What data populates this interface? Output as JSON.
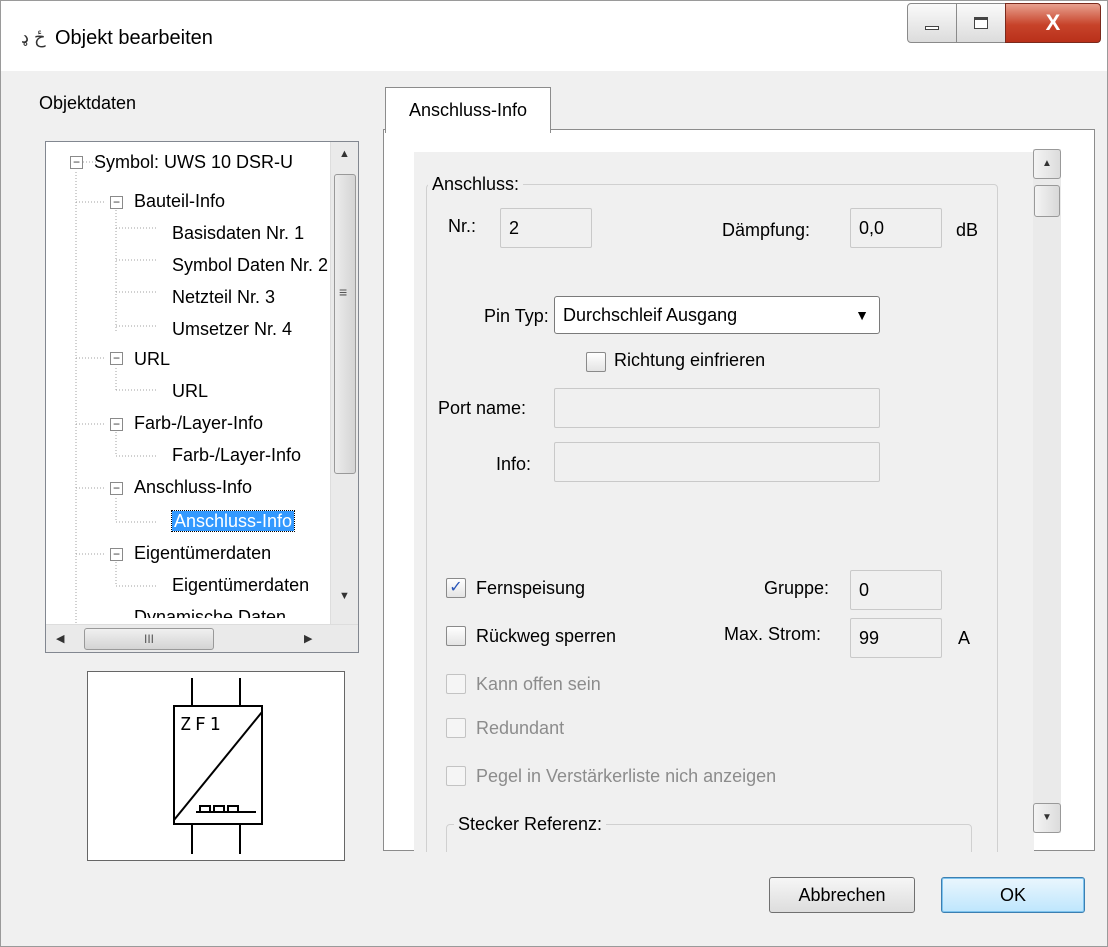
{
  "window": {
    "title": "Objekt bearbeiten",
    "icon_glyph": "ځ ډ",
    "minimize_icon": "minimize-icon",
    "maximize_icon": "maximize-icon",
    "close_glyph": "X"
  },
  "left": {
    "label": "Objektdaten",
    "tree": [
      {
        "label": "Symbol: UWS 10 DSR-U",
        "level": 0,
        "expandable": true
      },
      {
        "label": "Bauteil-Info",
        "level": 1,
        "expandable": true
      },
      {
        "label": "Basisdaten Nr. 1",
        "level": 2
      },
      {
        "label": "Symbol Daten Nr. 2",
        "level": 2
      },
      {
        "label": "Netzteil Nr. 3",
        "level": 2
      },
      {
        "label": "Umsetzer Nr. 4",
        "level": 2
      },
      {
        "label": "URL",
        "level": 1,
        "expandable": true
      },
      {
        "label": "URL",
        "level": 2
      },
      {
        "label": "Farb-/Layer-Info",
        "level": 1,
        "expandable": true
      },
      {
        "label": "Farb-/Layer-Info",
        "level": 2
      },
      {
        "label": "Anschluss-Info",
        "level": 1,
        "expandable": true
      },
      {
        "label": "Anschluss-Info",
        "level": 2,
        "selected": true
      },
      {
        "label": "Eigentümerdaten",
        "level": 1,
        "expandable": true
      },
      {
        "label": "Eigentümerdaten",
        "level": 2
      },
      {
        "label": "Dynamische Daten",
        "level": 1,
        "expandable": true
      }
    ],
    "hscroll_thumb": "III",
    "symbol_text": "ZF1"
  },
  "tab": {
    "label": "Anschluss-Info"
  },
  "form": {
    "anschluss_legend": "Anschluss:",
    "nr_label": "Nr.:",
    "nr_value": "2",
    "daempfung_label": "Dämpfung:",
    "daempfung_value": "0,0",
    "daempfung_unit": "dB",
    "pin_typ_label": "Pin Typ:",
    "pin_typ_value": "Durchschleif Ausgang",
    "richtung_label": "Richtung einfrieren",
    "richtung_checked": false,
    "port_name_label": "Port name:",
    "port_name_value": "",
    "info_label": "Info:",
    "info_value": "",
    "fernspeisung_label": "Fernspeisung",
    "fernspeisung_checked": true,
    "gruppe_label": "Gruppe:",
    "gruppe_value": "0",
    "rueckweg_label": "Rückweg sperren",
    "rueckweg_checked": false,
    "max_strom_label": "Max. Strom:",
    "max_strom_value": "99",
    "max_strom_unit": "A",
    "kann_offen_label": "Kann offen sein",
    "redundant_label": "Redundant",
    "pegel_label": "Pegel in Verstärkerliste nich anzeigen",
    "stecker_legend": "Stecker Referenz:"
  },
  "buttons": {
    "cancel": "Abbrechen",
    "ok": "OK"
  }
}
